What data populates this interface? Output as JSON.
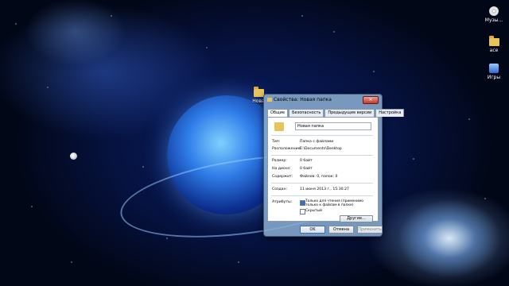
{
  "desktop": {
    "icons": [
      {
        "label": "Музы...",
        "icon": "cd-icon"
      },
      {
        "label": "ace",
        "icon": "folder-icon"
      },
      {
        "label": "Игры",
        "icon": "games-icon"
      }
    ],
    "folder_label": "Нова"
  },
  "dialog": {
    "title": "Свойства: Новая папка",
    "close_label": "×",
    "tabs": [
      "Общие",
      "Безопасность",
      "Предыдущие версии",
      "Настройка"
    ],
    "name_value": "Новая папка",
    "rows": [
      {
        "label": "Тип:",
        "value": "Папка с файлами"
      },
      {
        "label": "Расположение:",
        "value": "E:\\Documents\\Desktop"
      },
      {
        "label": "Размер:",
        "value": "0 байт"
      },
      {
        "label": "На диске:",
        "value": "0 байт"
      },
      {
        "label": "Содержит:",
        "value": "Файлов: 0, папок: 0"
      },
      {
        "label": "Создан:",
        "value": "11 июня 2013 г., 15:30:27"
      },
      {
        "label": "Атрибуты:",
        "value": ""
      }
    ],
    "attributes": {
      "readonly_label": "Только для чтения (применимо только к файлам в папке)",
      "hidden_label": "Скрытый",
      "other_button": "Другие..."
    },
    "buttons": {
      "ok": "OK",
      "cancel": "Отмена",
      "apply": "Применить"
    }
  }
}
